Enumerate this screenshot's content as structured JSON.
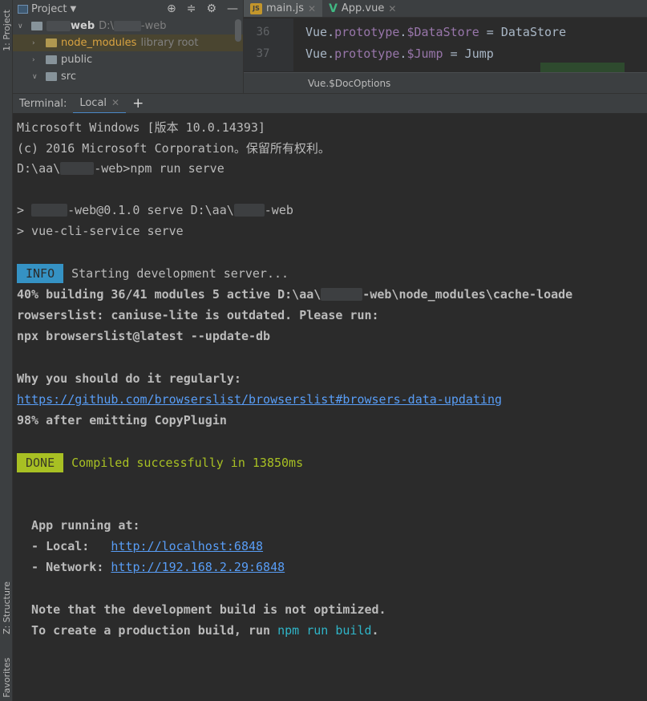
{
  "left_strip": {
    "project_tab": "1: Project",
    "structure_tab": "Z: Structure",
    "favorites_tab": "Favorites"
  },
  "project": {
    "title": "Project",
    "dropdown_icon": "caret-down-icon",
    "header_icons": [
      "crosshair-icon",
      "collapse-icon",
      "gear-icon",
      "minimize-icon"
    ],
    "root": {
      "name": "web",
      "path": "D:\\",
      "path_suffix": "-web"
    },
    "items": [
      {
        "name": "node_modules",
        "hint": "library root",
        "expanded": false
      },
      {
        "name": "public",
        "expanded": false
      },
      {
        "name": "src",
        "expanded": true
      }
    ]
  },
  "editor": {
    "tabs": [
      {
        "label": "main.js",
        "icon": "js-file-icon",
        "active": true
      },
      {
        "label": "App.vue",
        "icon": "vue-file-icon",
        "active": false
      }
    ],
    "lines": [
      {
        "number": "36",
        "obj": "Vue.",
        "proto": "prototype",
        "dot": ".",
        "member": "$DataStore",
        "rest": " = DataStore"
      },
      {
        "number": "37",
        "obj": "Vue.",
        "proto": "prototype",
        "dot": ".",
        "member": "$Jump",
        "rest": " = Jump"
      }
    ],
    "completion": "Vue.$DocOptions"
  },
  "terminal_bar": {
    "label": "Terminal:",
    "tab": "Local",
    "add": "+"
  },
  "terminal": {
    "l1": "Microsoft Windows [版本 10.0.14393]",
    "l2": "(c) 2016 Microsoft Corporation。保留所有权利。",
    "l3a": "D:\\aa\\",
    "l3b": "-web>npm run serve",
    "l4a": "> ",
    "l4b": "-web@0.1.0 serve D:\\aa\\",
    "l4c": "-web",
    "l5": "> vue-cli-service serve",
    "info_badge": "INFO",
    "info_text": "Starting development server...",
    "l7a": "40% building 36/41 modules 5 active D:\\aa\\",
    "l7b": "-web\\node_modules\\cache-loade",
    "l8": "rowserslist: caniuse-lite is outdated. Please run:",
    "l9": "npx browserslist@latest --update-db",
    "l10": "Why you should do it regularly:",
    "l11": "https://github.com/browserslist/browserslist#browsers-data-updating",
    "l12": "98% after emitting CopyPlugin",
    "done_badge": "DONE",
    "done_text": "Compiled successfully in 13850ms",
    "l14": "  App running at:",
    "l15a": "  - Local:   ",
    "l15b": "http://localhost:6848",
    "l16a": "  - Network: ",
    "l16b": "http://192.168.2.29:6848",
    "l17": "  Note that the development build is not optimized.",
    "l18a": "  To create a production build, run ",
    "l18b": "npm run build",
    "l18c": "."
  }
}
